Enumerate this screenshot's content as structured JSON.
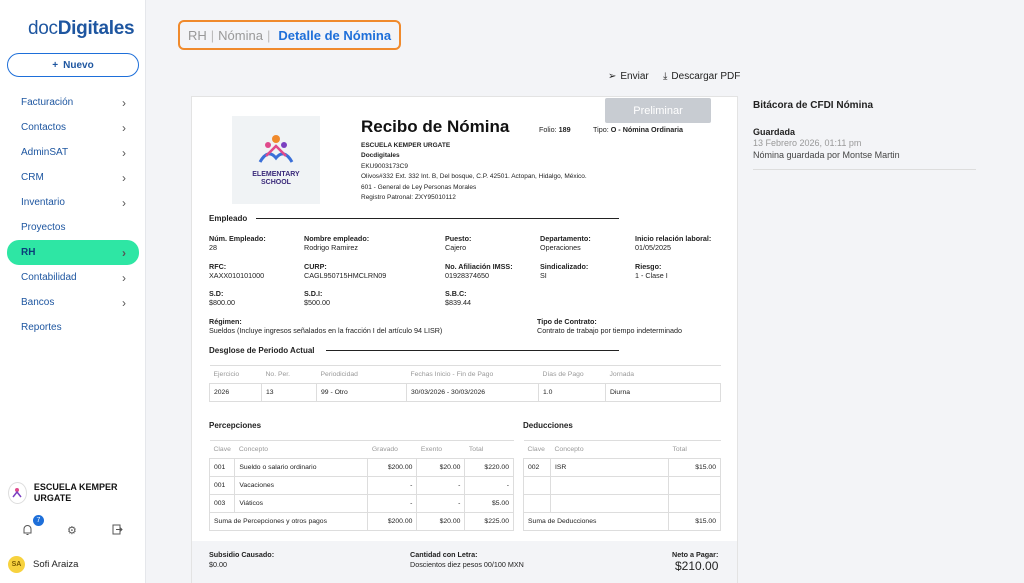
{
  "app": {
    "logo_light": "doc",
    "logo_bold": "Digitales"
  },
  "sidebar": {
    "new_label": "Nuevo",
    "items": [
      {
        "label": "Facturación",
        "chevron": true
      },
      {
        "label": "Contactos",
        "chevron": true
      },
      {
        "label": "AdminSAT",
        "chevron": true
      },
      {
        "label": "CRM",
        "chevron": true
      },
      {
        "label": "Inventario",
        "chevron": true
      },
      {
        "label": "Proyectos",
        "chevron": false
      },
      {
        "label": "RH",
        "chevron": true,
        "active": true
      },
      {
        "label": "Contabilidad",
        "chevron": true
      },
      {
        "label": "Bancos",
        "chevron": true
      },
      {
        "label": "Reportes",
        "chevron": false
      }
    ],
    "org_name": "ESCUELA KEMPER URGATE",
    "notifications": "7",
    "user_initials": "SA",
    "user_name": "Sofi Araiza"
  },
  "breadcrumb": {
    "a": "RH",
    "b": "Nómina",
    "current": "Detalle de Nómina"
  },
  "toolbar": {
    "send": "Enviar",
    "download": "Descargar PDF"
  },
  "receipt": {
    "preliminar": "Preliminar",
    "title": "Recibo de Nómina",
    "folio_label": "Folio:",
    "folio": "189",
    "tipo_label": "Tipo:",
    "tipo": "O - Nómina Ordinaria",
    "school_line1": "ELEMENTARY",
    "school_line2": "SCHOOL",
    "emisor": "ESCUELA KEMPER URGATE",
    "emisor2": "Docdigitales",
    "rfc": "EKU9003173C9",
    "address": "Olivos#332 Ext. 332 Int. B, Del bosque, C.P. 42501. Actopan, Hidalgo, México.",
    "regimen_emisor": "601 - General de Ley Personas Morales",
    "registro": "Registro Patronal: ZXY95010112",
    "empleado_title": "Empleado",
    "fields": {
      "num_l": "Núm. Empleado:",
      "num": "28",
      "nombre_l": "Nombre empleado:",
      "nombre": "Rodrigo Ramirez",
      "puesto_l": "Puesto:",
      "puesto": "Cajero",
      "depto_l": "Departamento:",
      "depto": "Operaciones",
      "inicio_l": "Inicio relación laboral:",
      "inicio": "01/05/2025",
      "rfc_l": "RFC:",
      "rfc": "XAXX010101000",
      "curp_l": "CURP:",
      "curp": "CAGL950715HMCLRN09",
      "imss_l": "No. Afiliación IMSS:",
      "imss": "01928374650",
      "sind_l": "Sindicalizado:",
      "sind": "SI",
      "riesgo_l": "Riesgo:",
      "riesgo": "1 - Clase I",
      "sd_l": "S.D:",
      "sd": "$800.00",
      "sdi_l": "S.D.I:",
      "sdi": "$500.00",
      "sbc_l": "S.B.C:",
      "sbc": "$839.44",
      "regimen_l": "Régimen:",
      "regimen": "Sueldos (Incluye ingresos señalados en la fracción I del artículo 94 LISR)",
      "contrato_l": "Tipo de Contrato:",
      "contrato": "Contrato de trabajo por tiempo indeterminado"
    },
    "periodo_title": "Desglose de Periodo Actual",
    "periodo_headers": [
      "Ejercicio",
      "No. Per.",
      "Periodicidad",
      "Fechas Inicio - Fin de Pago",
      "Días de Pago",
      "Jornada"
    ],
    "periodo_row": [
      "2026",
      "13",
      "99 - Otro",
      "30/03/2026 - 30/03/2026",
      "1.0",
      "Diurna"
    ],
    "percepciones_title": "Percepciones",
    "perc_headers": [
      "Clave",
      "Concepto",
      "Gravado",
      "Exento",
      "Total"
    ],
    "perc_rows": [
      [
        "001",
        "Sueldo o salario ordinario",
        "$200.00",
        "$20.00",
        "$220.00"
      ],
      [
        "001",
        "Vacaciones",
        "-",
        "-",
        "-"
      ],
      [
        "003",
        "Viáticos",
        "-",
        "-",
        "$5.00"
      ]
    ],
    "perc_sum": [
      "Suma de Percepciones y otros pagos",
      "$200.00",
      "$20.00",
      "$225.00"
    ],
    "deducciones_title": "Deducciones",
    "ded_headers": [
      "Clave",
      "Concepto",
      "Total"
    ],
    "ded_rows": [
      [
        "002",
        "ISR",
        "$15.00"
      ],
      [
        "",
        "",
        ""
      ],
      [
        "",
        "",
        ""
      ]
    ],
    "ded_sum": [
      "Suma de Deducciones",
      "$15.00"
    ],
    "subsidio_l": "Subsidio Causado:",
    "subsidio": "$0.00",
    "letra_l": "Cantidad con Letra:",
    "letra": "Doscientos diez pesos 00/100 MXN",
    "neto_l": "Neto a Pagar:",
    "neto": "$210.00"
  },
  "bitacora": {
    "title": "Bitácora de CFDI Nómina",
    "status": "Guardada",
    "date": "13 Febrero 2026, 01:11 pm",
    "note": "Nómina guardada por Montse Martin"
  }
}
